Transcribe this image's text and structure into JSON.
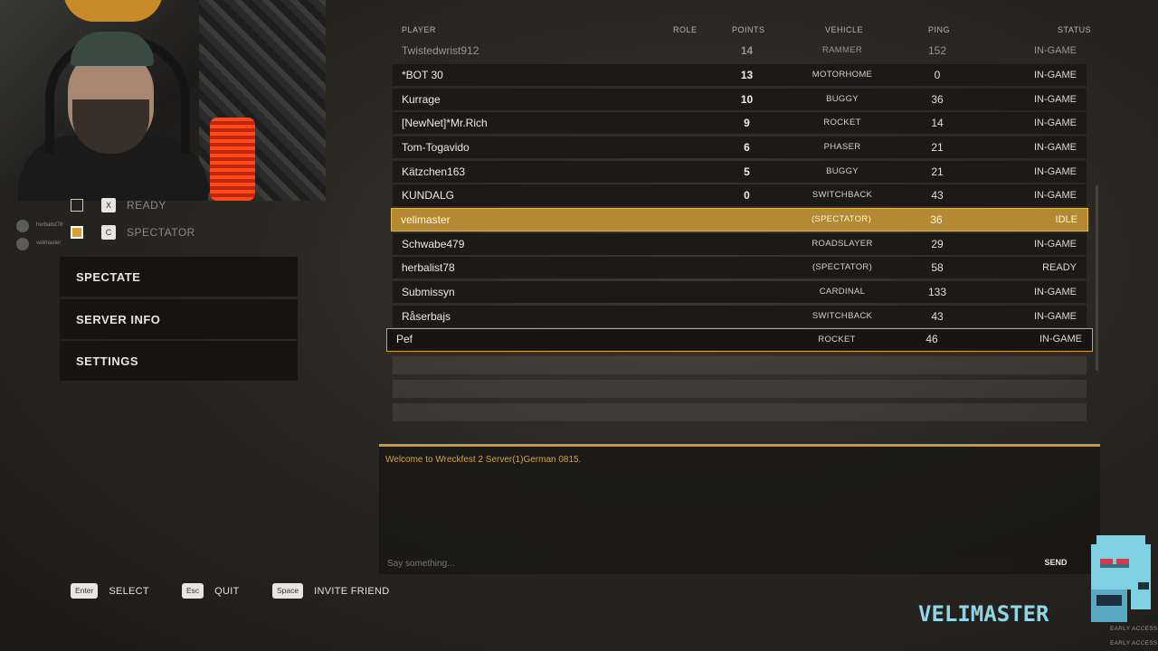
{
  "webcam": {
    "label": "streamer webcam"
  },
  "left_panel": {
    "ready": {
      "key": "X",
      "label": "READY"
    },
    "spectator": {
      "key": "C",
      "label": "SPECTATOR"
    },
    "small_users": [
      "herbalist78",
      "velimaster"
    ],
    "menu": [
      "SPECTATE",
      "SERVER INFO",
      "SETTINGS"
    ]
  },
  "scoreboard": {
    "headers": {
      "player": "PLAYER",
      "role": "ROLE",
      "points": "POINTS",
      "vehicle": "VEHICLE",
      "ping": "PING",
      "status": "STATUS"
    },
    "rows": [
      {
        "player": "Twistedwrist912",
        "points": "14",
        "vehicle": "RAMMER",
        "ping": "152",
        "status": "IN-GAME"
      },
      {
        "player": "*BOT 30",
        "points": "13",
        "vehicle": "MOTORHOME",
        "ping": "0",
        "status": "IN-GAME"
      },
      {
        "player": "Kurrage",
        "points": "10",
        "vehicle": "BUGGY",
        "ping": "36",
        "status": "IN-GAME"
      },
      {
        "player": "[NewNet]*Mr.Rich",
        "points": "9",
        "vehicle": "ROCKET",
        "ping": "14",
        "status": "IN-GAME"
      },
      {
        "player": "Tom-Togavido",
        "points": "6",
        "vehicle": "PHASER",
        "ping": "21",
        "status": "IN-GAME"
      },
      {
        "player": "Kätzchen163",
        "points": "5",
        "vehicle": "BUGGY",
        "ping": "21",
        "status": "IN-GAME"
      },
      {
        "player": "KUNDALG",
        "points": "0",
        "vehicle": "SWITCHBACK",
        "ping": "43",
        "status": "IN-GAME"
      },
      {
        "player": "velimaster",
        "points": "",
        "vehicle": "(SPECTATOR)",
        "ping": "36",
        "status": "IDLE"
      },
      {
        "player": "Schwabe479",
        "points": "",
        "vehicle": "ROADSLAYER",
        "ping": "29",
        "status": "IN-GAME"
      },
      {
        "player": "herbalist78",
        "points": "",
        "vehicle": "(SPECTATOR)",
        "ping": "58",
        "status": "READY"
      },
      {
        "player": "Submissyn",
        "points": "",
        "vehicle": "CARDINAL",
        "ping": "133",
        "status": "IN-GAME"
      },
      {
        "player": "Råserbajs",
        "points": "",
        "vehicle": "SWITCHBACK",
        "ping": "43",
        "status": "IN-GAME"
      },
      {
        "player": "Pef",
        "points": "",
        "vehicle": "ROCKET",
        "ping": "46",
        "status": "IN-GAME"
      }
    ]
  },
  "chat": {
    "message": "Welcome to Wreckfest 2 Server(1)German 0815.",
    "placeholder": "Say something...",
    "send": "SEND"
  },
  "hints": [
    {
      "key": "Enter",
      "label": "SELECT"
    },
    {
      "key": "Esc",
      "label": "QUIT"
    },
    {
      "key": "Space",
      "label": "INVITE FRIEND"
    }
  ],
  "branding": {
    "logo_text": "VELIMASTER",
    "early_access_1": "EARLY ACCESS",
    "early_access_2": "EARLY ACCESS"
  },
  "colors": {
    "accent": "#d09a2a",
    "highlight_row": "#b38a33",
    "logo": "#8fd6e6"
  }
}
